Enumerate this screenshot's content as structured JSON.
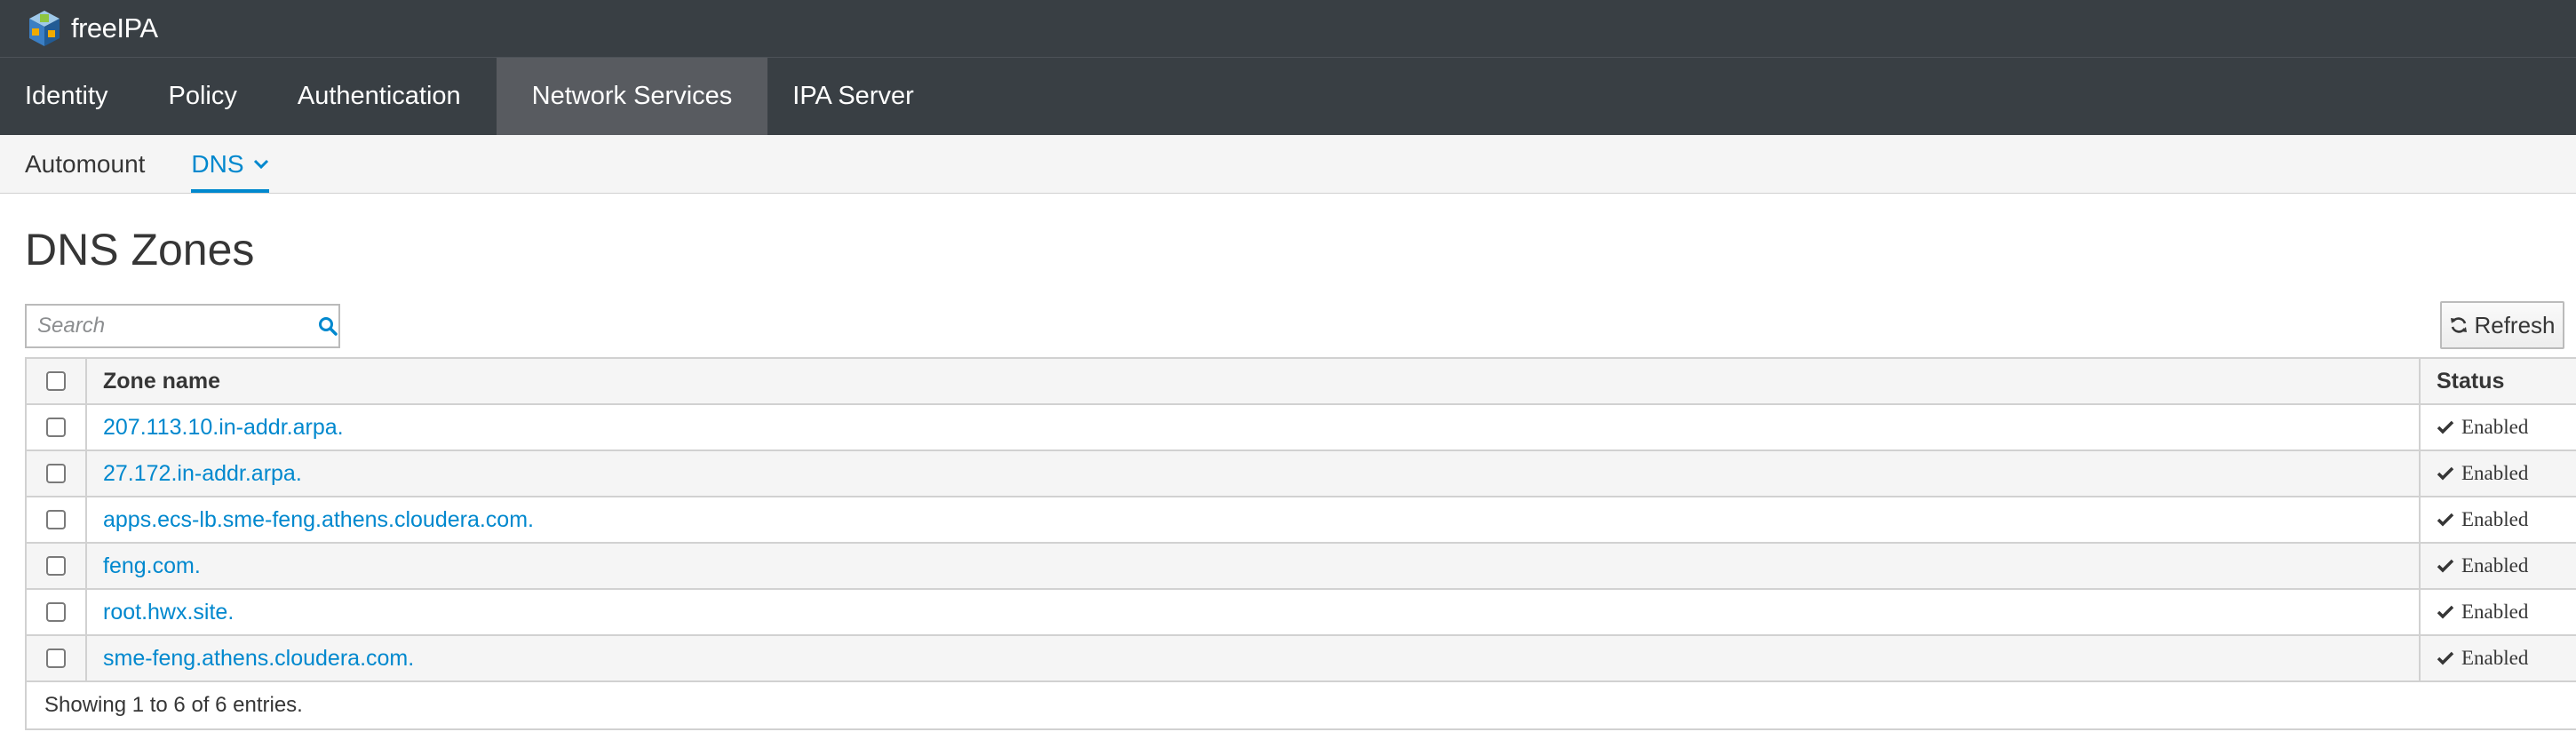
{
  "brand": {
    "name": "freeIPA",
    "logo_icon": "freeipa-cube-logo"
  },
  "primary_nav": [
    {
      "label": "Identity",
      "active": false
    },
    {
      "label": "Policy",
      "active": false
    },
    {
      "label": "Authentication",
      "active": false
    },
    {
      "label": "Network Services",
      "active": true
    },
    {
      "label": "IPA Server",
      "active": false
    }
  ],
  "secondary_nav": [
    {
      "label": "Automount",
      "active": false
    },
    {
      "label": "DNS",
      "active": true,
      "icon": "chevron-down-icon"
    }
  ],
  "page": {
    "title": "DNS Zones"
  },
  "search": {
    "placeholder": "Search",
    "value": "",
    "icon": "search-icon"
  },
  "toolbar": {
    "refresh_label": "Refresh",
    "refresh_icon": "refresh-icon"
  },
  "table": {
    "columns": {
      "name": "Zone name",
      "status": "Status"
    },
    "rows": [
      {
        "name": "207.113.10.in-addr.arpa.",
        "status": "Enabled"
      },
      {
        "name": "27.172.in-addr.arpa.",
        "status": "Enabled"
      },
      {
        "name": "apps.ecs-lb.sme-feng.athens.cloudera.com.",
        "status": "Enabled"
      },
      {
        "name": "feng.com.",
        "status": "Enabled"
      },
      {
        "name": "root.hwx.site.",
        "status": "Enabled"
      },
      {
        "name": "sme-feng.athens.cloudera.com.",
        "status": "Enabled"
      }
    ],
    "footer": "Showing 1 to 6 of 6 entries."
  },
  "colors": {
    "masthead": "#393f44",
    "active_tab": "#585b60",
    "link": "#0088ce"
  }
}
